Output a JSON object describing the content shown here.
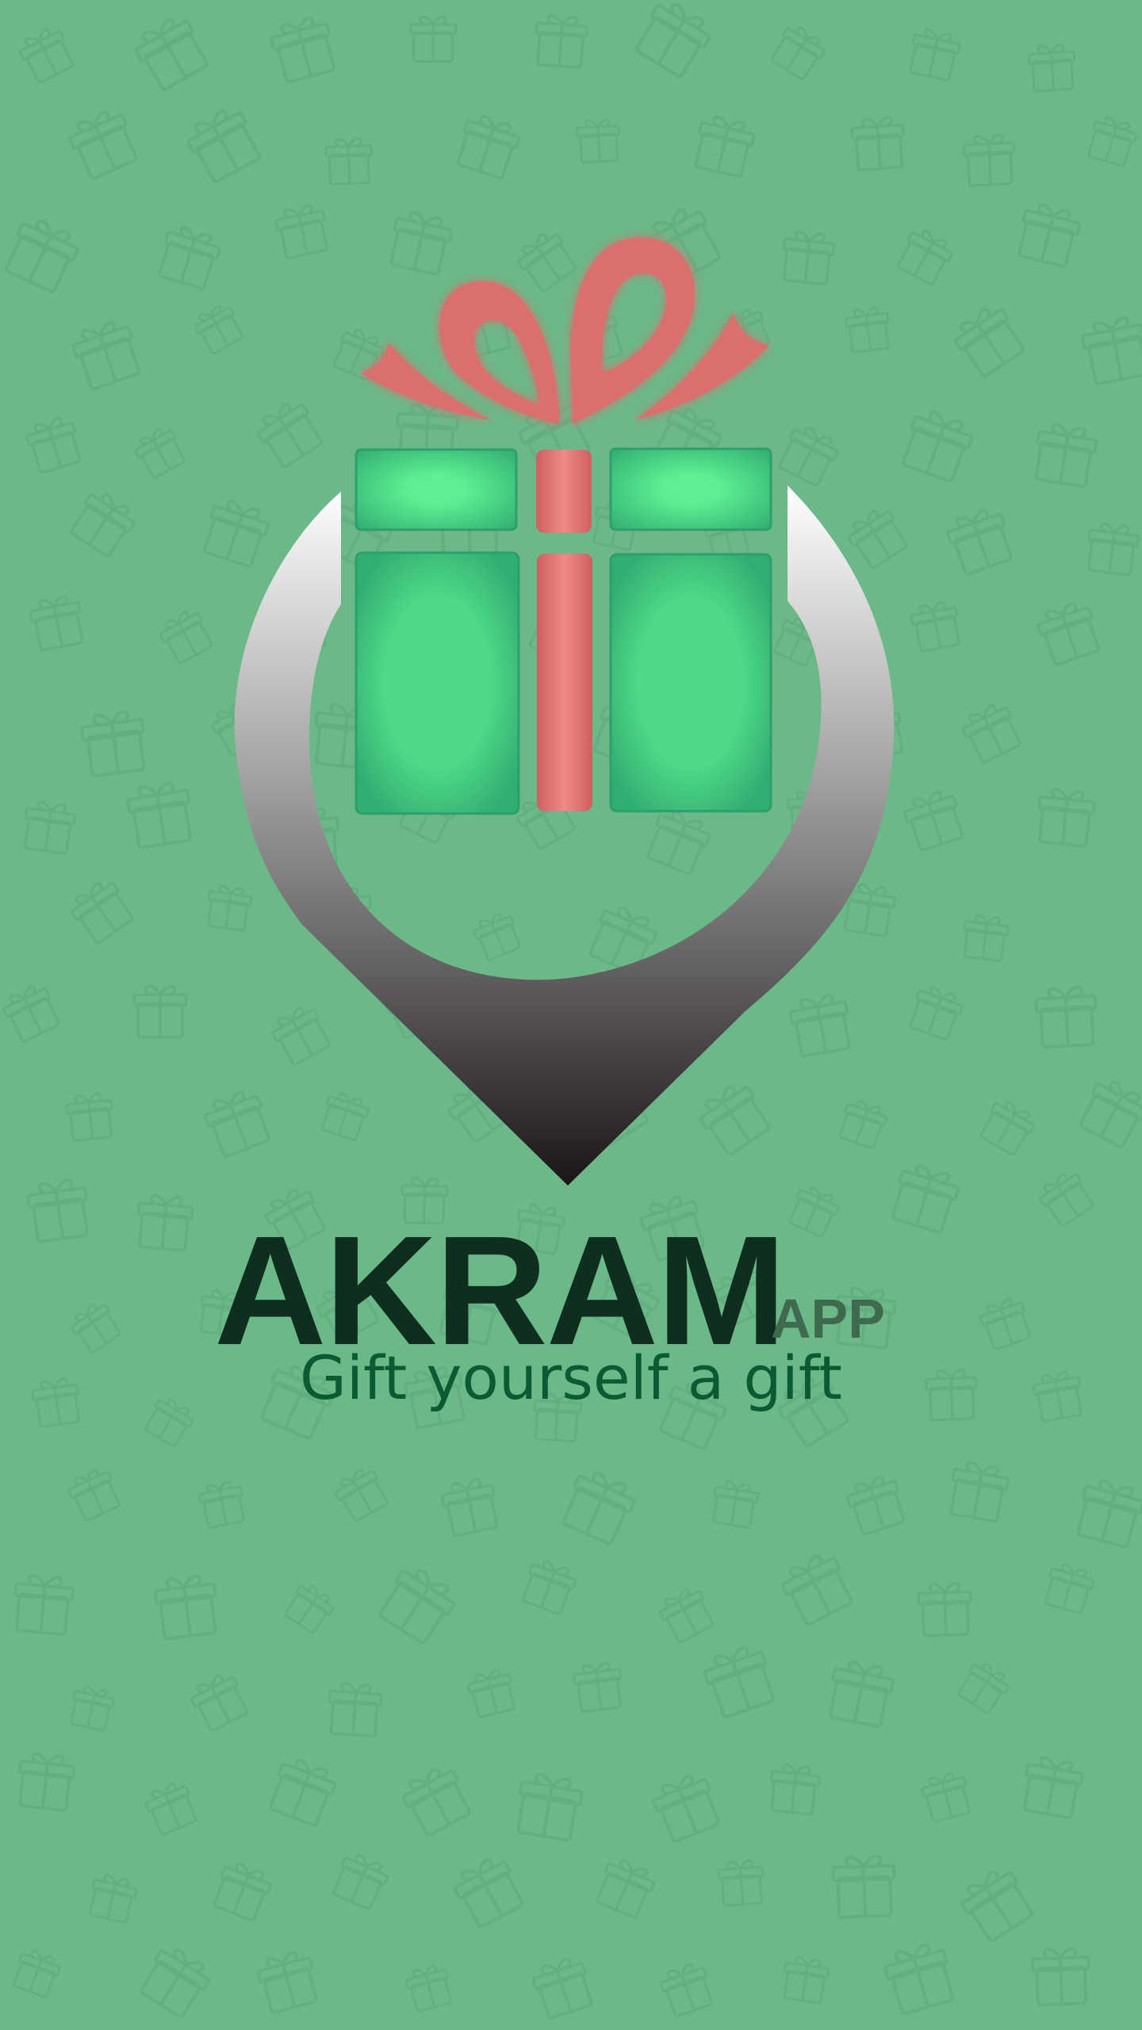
{
  "splash": {
    "brand_name": "AKRAM",
    "brand_suffix": "APP",
    "tagline": "Gift yourself a gift"
  },
  "logo": {
    "icon": "gift-location-pin-icon"
  },
  "background": {
    "pattern_icon": "gift-box-pattern"
  },
  "colors": {
    "background": "#6bb888",
    "gift_green": "#4fd887",
    "ribbon": "#d9706e",
    "brand_text": "#0f2e20",
    "tagline_text": "#0b5a34",
    "suffix_text": "#3f6a4f"
  }
}
